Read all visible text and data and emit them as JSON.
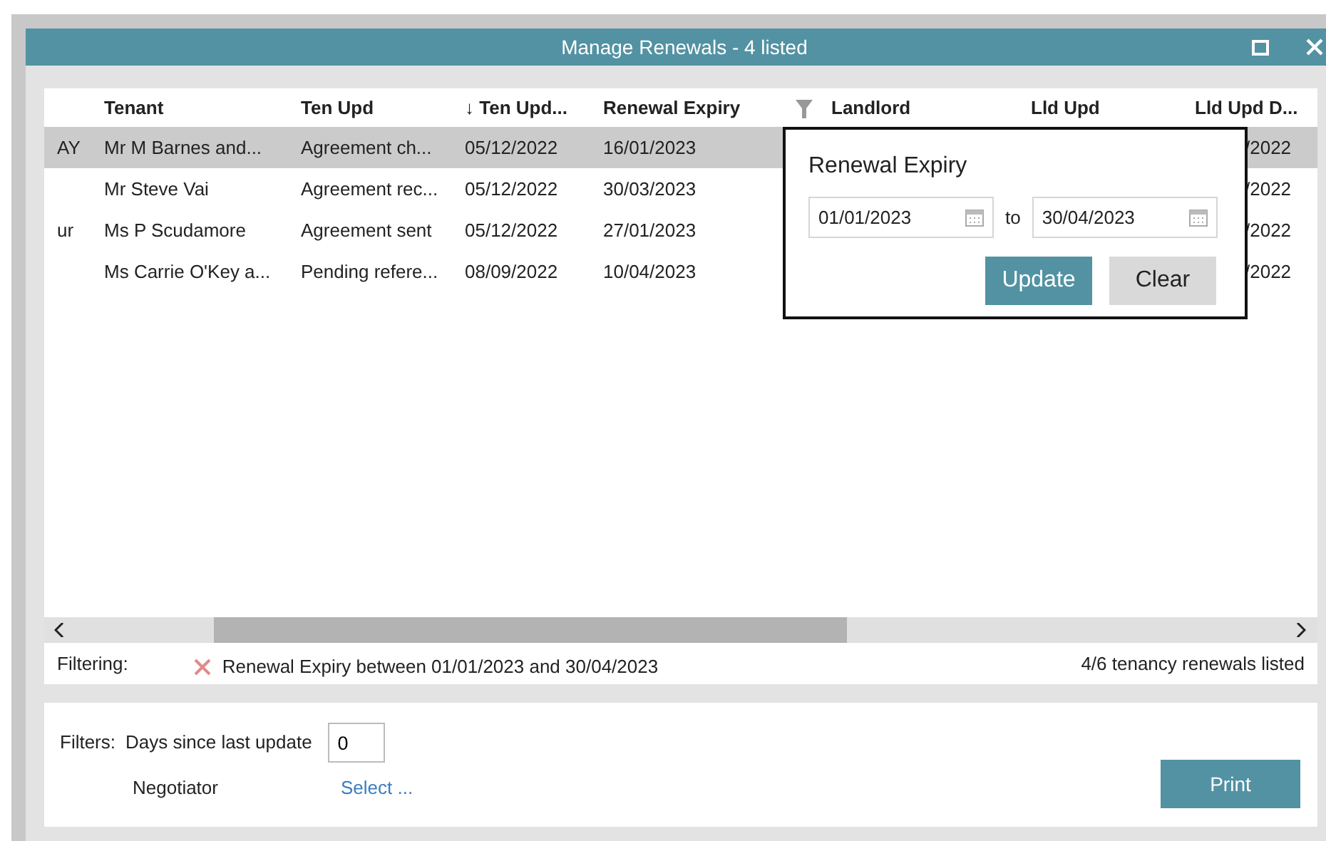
{
  "window": {
    "title": "Manage Renewals - 4 listed"
  },
  "table": {
    "columns": [
      {
        "kind": "blank"
      },
      {
        "label": "Tenant"
      },
      {
        "label": "Ten Upd"
      },
      {
        "label": "↓ Ten Upd..."
      },
      {
        "label": "Renewal Expiry"
      },
      {
        "kind": "filter"
      },
      {
        "label": "Landlord"
      },
      {
        "label": "Lld Upd"
      },
      {
        "label": "Lld Upd D..."
      }
    ],
    "rows": [
      {
        "selected": true,
        "cells": [
          "AY",
          "Mr M Barnes and...",
          "Agreement ch...",
          "05/12/2022",
          "16/01/2023",
          "",
          "",
          "",
          "/2022"
        ]
      },
      {
        "selected": false,
        "cells": [
          "",
          "Mr Steve Vai",
          "Agreement rec...",
          "05/12/2022",
          "30/03/2023",
          "",
          "",
          "",
          "/2022"
        ]
      },
      {
        "selected": false,
        "cells": [
          "ur",
          "Ms P Scudamore",
          "Agreement sent",
          "05/12/2022",
          "27/01/2023",
          "",
          "",
          "",
          "/2022"
        ]
      },
      {
        "selected": false,
        "cells": [
          "",
          "Ms Carrie O'Key a...",
          "Pending refere...",
          "08/09/2022",
          "10/04/2023",
          "",
          "",
          "",
          "/2022"
        ]
      }
    ]
  },
  "filter_popup": {
    "title": "Renewal Expiry",
    "from": "01/01/2023",
    "separator": "to",
    "to": "30/04/2023",
    "buttons": [
      "Update",
      "Clear"
    ]
  },
  "status": {
    "label": "Filtering:",
    "filter_text": "Renewal Expiry between 01/01/2023 and 30/04/2023",
    "count": "4/6 tenancy renewals listed"
  },
  "filters": {
    "label": "Filters:",
    "days_label": "Days since last update",
    "days_value": "0",
    "negotiator_label": "Negotiator",
    "negotiator_link": "Select ...",
    "print": "Print"
  }
}
